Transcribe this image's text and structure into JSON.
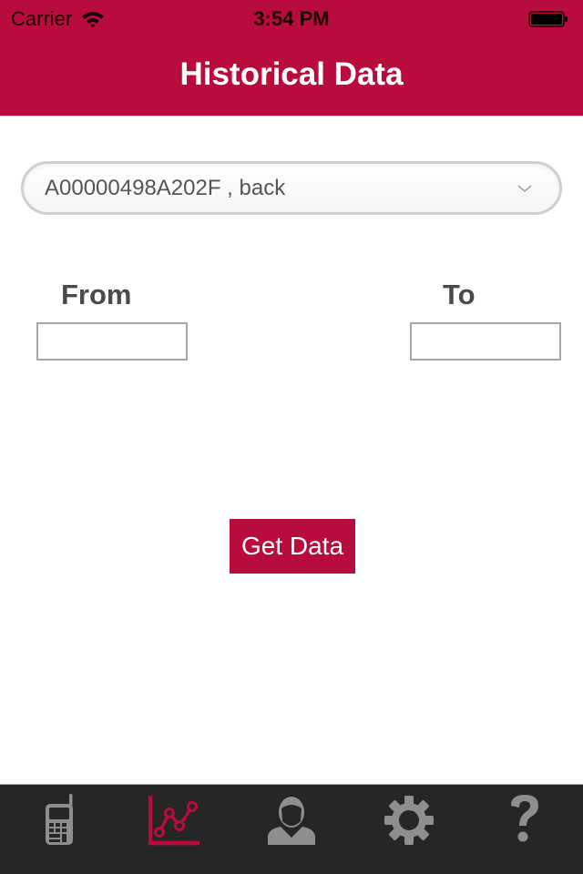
{
  "status_bar": {
    "carrier": "Carrier",
    "time": "3:54 PM",
    "wifi_icon": "wifi-icon",
    "battery_icon": "battery-icon"
  },
  "header": {
    "title": "Historical Data"
  },
  "device_select": {
    "value": "A00000498A202F , back",
    "icon": "chevron-down-icon"
  },
  "date_range": {
    "from_label": "From",
    "from_value": "",
    "to_label": "To",
    "to_value": ""
  },
  "actions": {
    "get_data_label": "Get Data"
  },
  "tabbar": {
    "active_index": 1,
    "tabs": [
      {
        "name": "device",
        "icon": "mobile-phone-icon"
      },
      {
        "name": "historical-data",
        "icon": "line-chart-icon"
      },
      {
        "name": "profile",
        "icon": "user-icon"
      },
      {
        "name": "settings",
        "icon": "gear-icon"
      },
      {
        "name": "help",
        "icon": "question-mark-icon"
      }
    ]
  },
  "colors": {
    "brand": "#b80c3c",
    "tabbar_bg": "#262626",
    "tab_icon_inactive": "#8e8e8e",
    "tab_icon_active": "#b80c3c",
    "label_text": "#4a4a4a"
  }
}
